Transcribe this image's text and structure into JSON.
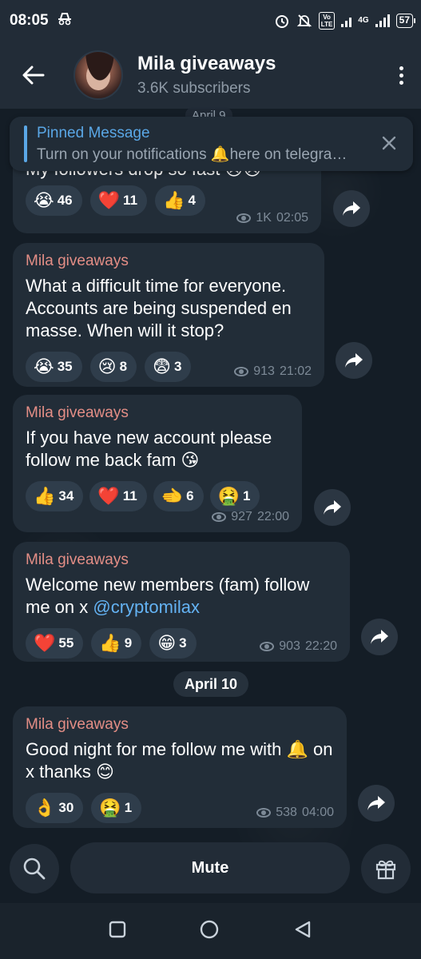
{
  "status_bar": {
    "time": "08:05",
    "network": "4G",
    "battery": "57"
  },
  "header": {
    "title": "Mila giveaways",
    "subtitle": "3.6K subscribers"
  },
  "pinned": {
    "label": "Pinned Message",
    "preview": "Turn on your notifications 🔔here on telegra…"
  },
  "ghost_date": "April 9",
  "messages": [
    {
      "text": "My followers drop so fast 😢😢",
      "reactions": [
        {
          "emoji": "😭",
          "count": "46"
        },
        {
          "emoji": "❤️",
          "count": "11"
        },
        {
          "emoji": "👍",
          "count": "4"
        }
      ],
      "views": "1K",
      "time": "02:05"
    },
    {
      "sender": "Mila giveaways",
      "text": "What a difficult time for everyone. Accounts are being suspended en masse. When will it stop?",
      "reactions": [
        {
          "emoji": "😭",
          "count": "35"
        },
        {
          "emoji": "😢",
          "count": "8"
        },
        {
          "emoji": "😨",
          "count": "3"
        }
      ],
      "views": "913",
      "time": "21:02"
    },
    {
      "sender": "Mila giveaways",
      "text": "If you have new account please follow me back fam 😘",
      "reactions": [
        {
          "emoji": "👍",
          "count": "34"
        },
        {
          "emoji": "❤️",
          "count": "11"
        },
        {
          "emoji": "🫲",
          "count": "6"
        },
        {
          "emoji": "🤮",
          "count": "1"
        }
      ],
      "views": "927",
      "time": "22:00"
    },
    {
      "sender": "Mila giveaways",
      "text_prefix": "Welcome new members (fam) follow me on x ",
      "link": "@cryptomilax",
      "reactions": [
        {
          "emoji": "❤️",
          "count": "55"
        },
        {
          "emoji": "👍",
          "count": "9"
        },
        {
          "emoji": "😁",
          "count": "3"
        }
      ],
      "views": "903",
      "time": "22:20"
    },
    {
      "sender": "Mila giveaways",
      "text": "Good night for me follow me with 🔔 on x thanks 😊",
      "reactions": [
        {
          "emoji": "👌",
          "count": "30"
        },
        {
          "emoji": "🤮",
          "count": "1"
        }
      ],
      "views": "538",
      "time": "04:00"
    }
  ],
  "date_chip": "April 10",
  "bottom": {
    "mute_label": "Mute"
  },
  "colors": {
    "background": "#141d26",
    "bubble": "#222d38",
    "sender": "#e48e86",
    "link": "#64b3f4",
    "accent": "#5aa7e6"
  }
}
